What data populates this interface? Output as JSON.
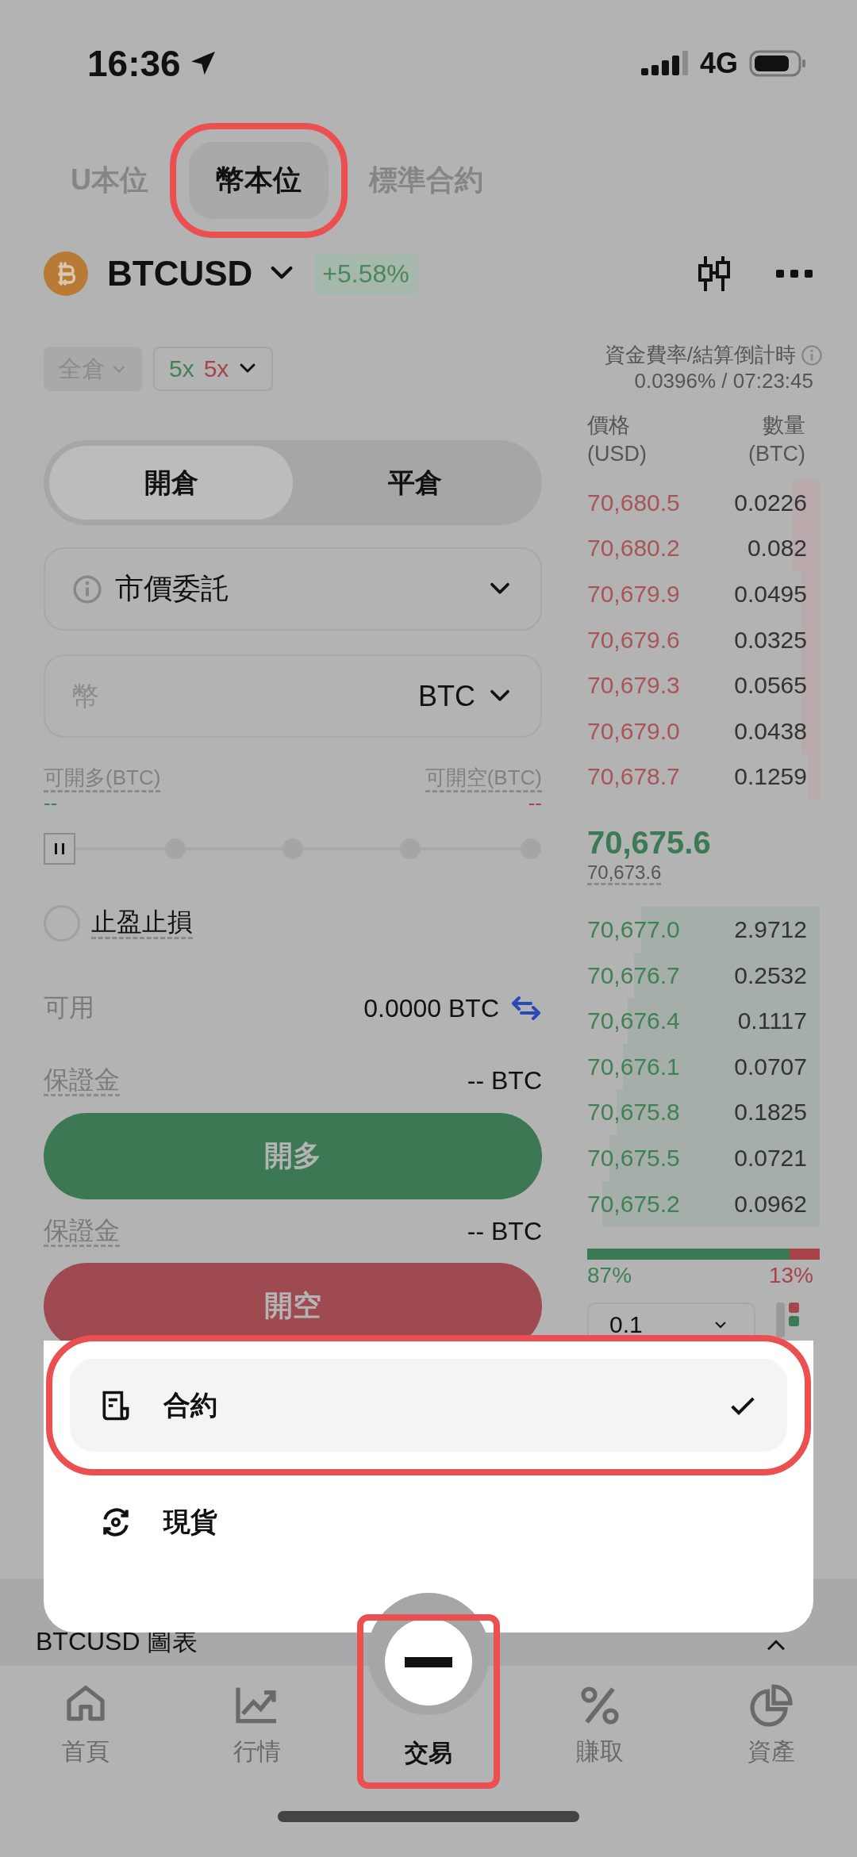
{
  "status_bar": {
    "time": "16:36",
    "network": "4G"
  },
  "contract_tabs": [
    {
      "label": "U本位",
      "selected": false,
      "highlighted": false
    },
    {
      "label": "幣本位",
      "selected": true,
      "highlighted": true
    },
    {
      "label": "標準合約",
      "selected": false,
      "highlighted": false
    }
  ],
  "symbol": {
    "name": "BTCUSD",
    "change": "+5.58%"
  },
  "margin_mode": "全倉",
  "leverage": {
    "long": "5x",
    "short": "5x"
  },
  "position_tabs": [
    {
      "label": "開倉",
      "selected": true
    },
    {
      "label": "平倉",
      "selected": false
    }
  ],
  "order_type": "市價委託",
  "amount": {
    "placeholder": "幣",
    "unit": "BTC"
  },
  "max_long": {
    "label": "可開多(BTC)",
    "value": "--"
  },
  "max_short": {
    "label": "可開空(BTC)",
    "value": "--"
  },
  "tp_sl": {
    "label": "止盈止損",
    "checked": false
  },
  "available": {
    "label": "可用",
    "value": "0.0000 BTC"
  },
  "long": {
    "margin_label": "保證金",
    "margin_value": "-- BTC",
    "button": "開多"
  },
  "short": {
    "margin_label": "保證金",
    "margin_value": "-- BTC",
    "button": "開空"
  },
  "funding": {
    "label": "資金費率/結算倒計時",
    "value": "0.0396% / 07:23:45"
  },
  "order_book": {
    "columns": [
      {
        "title": "價格",
        "unit": "(USD)"
      },
      {
        "title": "數量",
        "unit": "(BTC)"
      }
    ],
    "asks": [
      {
        "price": "70,680.5",
        "qty": "0.0226"
      },
      {
        "price": "70,680.2",
        "qty": "0.082"
      },
      {
        "price": "70,679.9",
        "qty": "0.0495"
      },
      {
        "price": "70,679.6",
        "qty": "0.0325"
      },
      {
        "price": "70,679.3",
        "qty": "0.0565"
      },
      {
        "price": "70,679.0",
        "qty": "0.0438"
      },
      {
        "price": "70,678.7",
        "qty": "0.1259"
      }
    ],
    "last_price": "70,675.6",
    "mark_price": "70,673.6",
    "bids": [
      {
        "price": "70,677.0",
        "qty": "2.9712"
      },
      {
        "price": "70,676.7",
        "qty": "0.2532"
      },
      {
        "price": "70,676.4",
        "qty": "0.1117"
      },
      {
        "price": "70,676.1",
        "qty": "0.0707"
      },
      {
        "price": "70,675.8",
        "qty": "0.1825"
      },
      {
        "price": "70,675.5",
        "qty": "0.0721"
      },
      {
        "price": "70,675.2",
        "qty": "0.0962"
      }
    ],
    "buy_ratio": {
      "level": 0.87,
      "buy": "87%",
      "sell": "13%"
    },
    "precision": "0.1"
  },
  "chart_bar": {
    "title": "BTCUSD 圖表"
  },
  "product_menu": [
    {
      "label": "合約",
      "kind": "document",
      "selected": true,
      "highlighted": true
    },
    {
      "label": "現貨",
      "kind": "exchange",
      "selected": false,
      "highlighted": false
    }
  ],
  "bottom_nav": [
    {
      "label": "首頁",
      "kind": "home",
      "selected": false,
      "highlighted": false
    },
    {
      "label": "行情",
      "kind": "chart",
      "selected": false,
      "highlighted": false
    },
    {
      "label": "交易",
      "kind": "trade",
      "selected": true,
      "highlighted": true
    },
    {
      "label": "賺取",
      "kind": "percent",
      "selected": false,
      "highlighted": false
    },
    {
      "label": "資產",
      "kind": "pie",
      "selected": false,
      "highlighted": false
    }
  ]
}
